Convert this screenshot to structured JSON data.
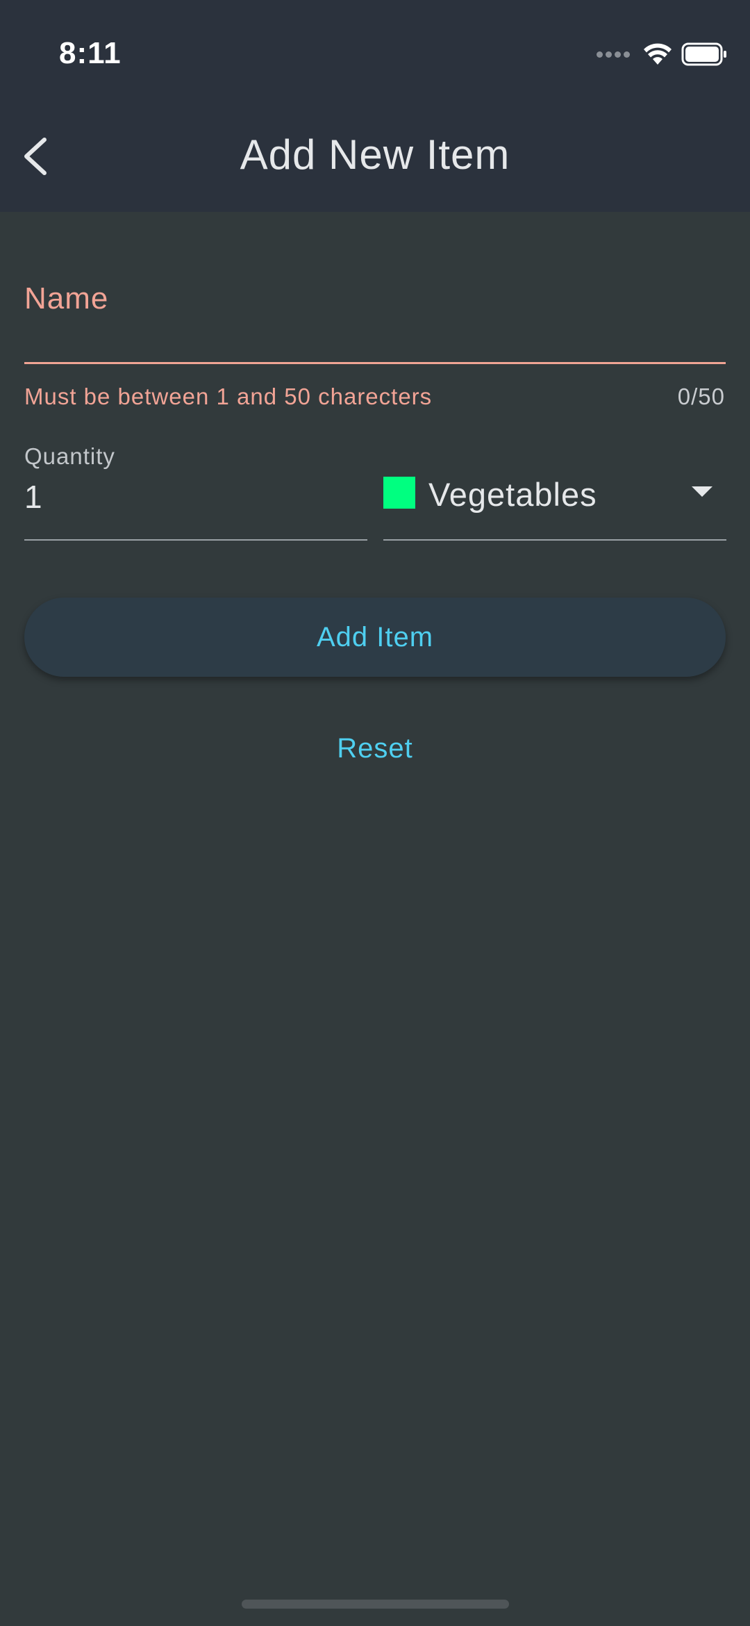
{
  "status_bar": {
    "time": "8:11"
  },
  "app_bar": {
    "title": "Add New Item",
    "back_icon": "chevron-left-icon"
  },
  "form": {
    "name": {
      "label": "Name",
      "value": "",
      "error": "Must be between 1 and 50 charecters",
      "counter": "0/50"
    },
    "quantity": {
      "label": "Quantity",
      "value": "1"
    },
    "category": {
      "selected": "Vegetables",
      "swatch_color": "#00ff80"
    }
  },
  "actions": {
    "add_label": "Add Item",
    "reset_label": "Reset"
  },
  "colors": {
    "error": "#f2a496",
    "accent": "#4fcff0",
    "app_bar": "#2b323d",
    "background": "#323a3c"
  }
}
